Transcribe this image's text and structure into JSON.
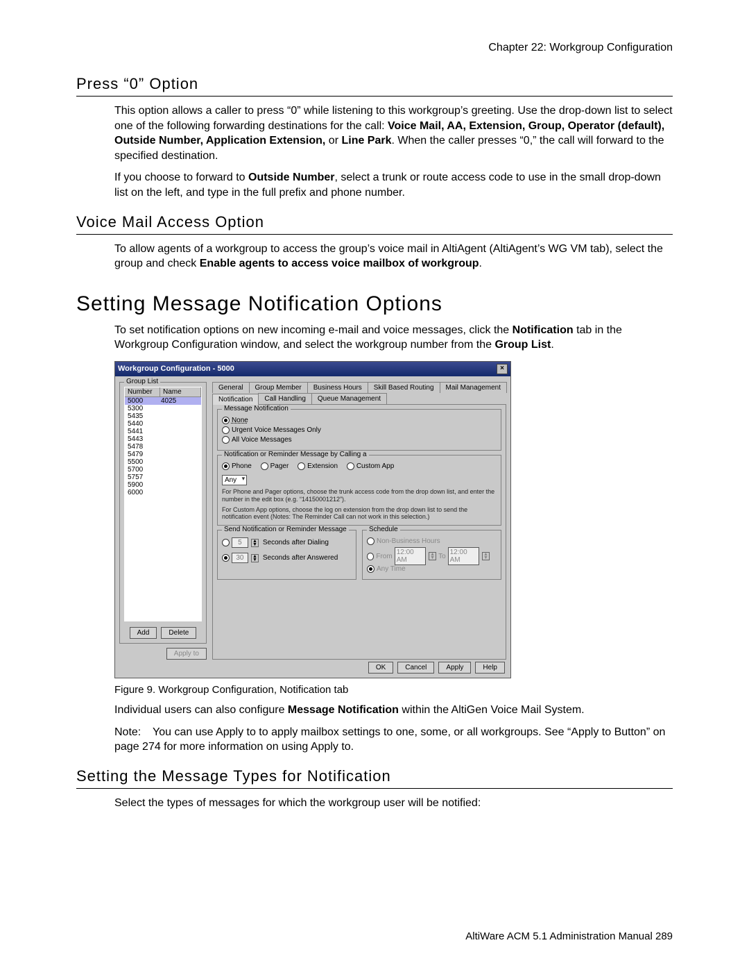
{
  "chapter_line": "Chapter 22:  Workgroup Configuration",
  "section1": {
    "title": "Press “0” Option",
    "p1a": "This option allows a caller to press “0” while listening to this workgroup’s greeting. Use the drop-down list to select one of the following forwarding destinations for the call: ",
    "p1b": "Voice Mail, AA, Extension, Group, Operator (default), Outside Number, Application Extension,",
    "p1c": " or ",
    "p1d": "Line Park",
    "p1e": ". When the caller presses “0,” the call will forward to the specified destination.",
    "p2a": "If you choose to forward to ",
    "p2b": "Outside Number",
    "p2c": ", select a trunk or route access code to use in the small drop-down list on the left, and type in the full prefix and phone number."
  },
  "section2": {
    "title": "Voice Mail Access Option",
    "p1a": "To allow agents of a workgroup to access the group’s voice mail in AltiAgent (AltiAgent’s WG VM tab), select the group and check ",
    "p1b": "Enable agents to access voice mailbox of workgroup",
    "p1c": "."
  },
  "h1": "Setting Message Notification Options",
  "section3": {
    "p1a": "To set notification options on new incoming e-mail and voice messages, click the ",
    "p1b": "Notification",
    "p1c": " tab in the Workgroup Configuration window, and select the workgroup number from the ",
    "p1d": "Group List",
    "p1e": "."
  },
  "fig_caption": "Figure 9.   Workgroup Configuration, Notification tab",
  "after_fig_a": "Individual users can also configure ",
  "after_fig_b": "Message Notification",
  "after_fig_c": " within the AltiGen Voice Mail System.",
  "note_label": "Note:",
  "note_a": "You can use ",
  "note_b": "Apply to",
  "note_c": " to apply mailbox settings to one, some, or all workgroups. See “Apply to Button” on page 274 for more information on using ",
  "note_d": "Apply to",
  "note_e": ".",
  "section4": {
    "title": "Setting the Message Types for Notification",
    "p1": "Select the types of messages for which the workgroup user will be notified:"
  },
  "footer": "AltiWare ACM 5.1 Administration Manual   289",
  "dialog": {
    "title": "Workgroup Configuration - 5000",
    "grouplist_label": "Group List",
    "grid_head_number": "Number",
    "grid_head_name": "Name",
    "rows": [
      {
        "num": "5000",
        "name": "4025",
        "sel": true
      },
      {
        "num": "5300",
        "name": ""
      },
      {
        "num": "5435",
        "name": ""
      },
      {
        "num": "5440",
        "name": ""
      },
      {
        "num": "5441",
        "name": ""
      },
      {
        "num": "5443",
        "name": ""
      },
      {
        "num": "5478",
        "name": ""
      },
      {
        "num": "5479",
        "name": ""
      },
      {
        "num": "5500",
        "name": ""
      },
      {
        "num": "5700",
        "name": ""
      },
      {
        "num": "5757",
        "name": ""
      },
      {
        "num": "5900",
        "name": ""
      },
      {
        "num": "6000",
        "name": ""
      }
    ],
    "btn_add": "Add",
    "btn_delete": "Delete",
    "btn_applyto": "Apply to",
    "tabs_row1": [
      "General",
      "Group Member",
      "Business Hours",
      "Skill Based Routing",
      "Mail Management"
    ],
    "tabs_row2": [
      "Notification",
      "Call Handling",
      "Queue Management"
    ],
    "msg_notif_label": "Message Notification",
    "mn_none": "None",
    "mn_urgent": "Urgent Voice Messages Only",
    "mn_all": "All Voice Messages",
    "by_calling_label": "Notification or Reminder Message by Calling a",
    "by_phone": "Phone",
    "by_pager": "Pager",
    "by_ext": "Extension",
    "by_custom": "Custom App",
    "dropdown_any": "Any",
    "help1": "For Phone and Pager options, choose the trunk access code from the drop down list, and enter the number in the edit box (e.g. “14150001212”).",
    "help2": "For Custom App options, choose the log on extension from the drop down list to send the notification event (Notes: The Reminder Call can not work in this selection.)",
    "send_label": "Send Notification or Reminder Message",
    "send_after_dial": "Seconds after Dialing",
    "send_after_ans": "Seconds after Answered",
    "send_val_dialing": "5",
    "send_val_ans": "30",
    "schedule_label": "Schedule",
    "sch_nonbiz": "Non-Business Hours",
    "sch_from": "From",
    "sch_to": "To",
    "sch_time1": "12:00 AM",
    "sch_time2": "12:00 AM",
    "sch_any": "Any Time",
    "btn_ok": "OK",
    "btn_cancel": "Cancel",
    "btn_apply": "Apply",
    "btn_help": "Help"
  }
}
